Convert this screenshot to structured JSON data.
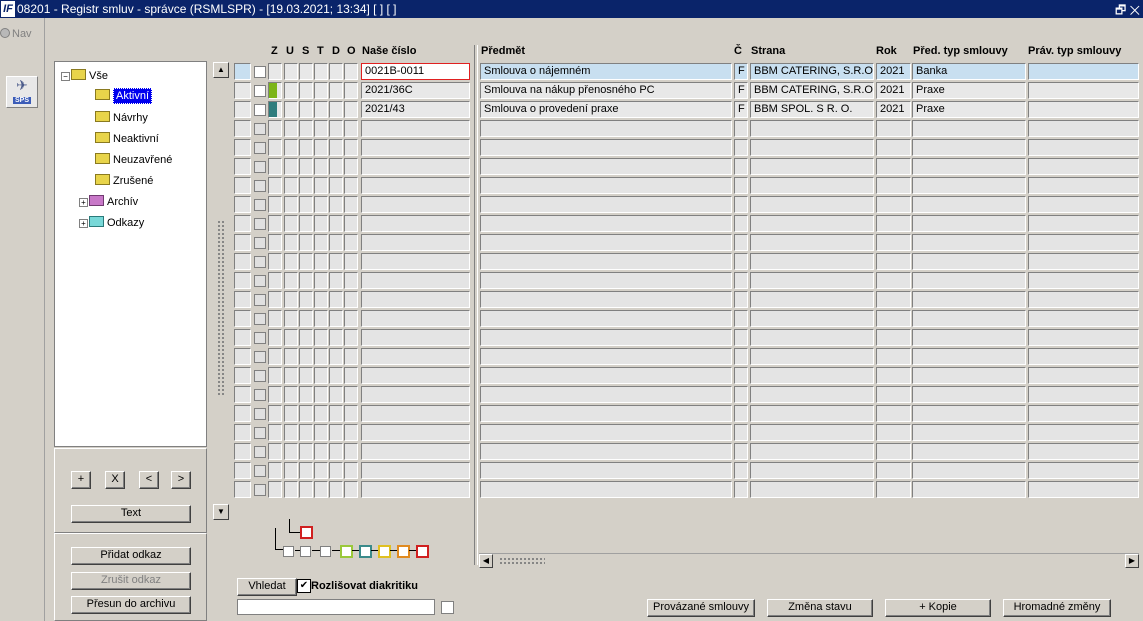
{
  "titlebar": {
    "logo": "IF",
    "title": "08201 - Registr smluv - správce (RSMLSPR) - [19.03.2021; 13:34]  [ ]  [ ]",
    "restore": "🗗",
    "close": "✕"
  },
  "nav": {
    "label": "Nav",
    "sps_label": "SPS"
  },
  "tree": {
    "root": "Vše",
    "items": [
      "Aktivní",
      "Návrhy",
      "Neaktivní",
      "Neuzavřené",
      "Zrušené"
    ],
    "archiv": "Archív",
    "odkazy": "Odkazy"
  },
  "tree_buttons": {
    "add": "+",
    "remove": "X",
    "prev": "<",
    "next": ">",
    "text": "Text"
  },
  "actions": {
    "add_link": "Přidat odkaz",
    "cancel_link": "Zrušit odkaz",
    "move_archive": "Přesun do archivu"
  },
  "grid": {
    "headers": {
      "z": "Z",
      "u": "U",
      "s": "S",
      "t": "T",
      "d": "D",
      "o": "O",
      "cislo": "Naše číslo",
      "predmet": "Předmět",
      "c": "Č",
      "strana": "Strana",
      "rok": "Rok",
      "pred_typ": "Před. typ smlouvy",
      "prav_typ": "Práv. typ smlouvy"
    },
    "rows": [
      {
        "cislo": "0021B-0011",
        "predmet": "Smlouva o nájemném",
        "c": "F",
        "strana": "BBM CATERING, S.R.O. Ú",
        "rok": "2021",
        "pred_typ": "Banka",
        "prav_typ": "",
        "status_color": ""
      },
      {
        "cislo": "2021/36C",
        "predmet": "Smlouva na nákup přenosného PC",
        "c": "F",
        "strana": "BBM CATERING, S.R.O. Ú",
        "rok": "2021",
        "pred_typ": "Praxe",
        "prav_typ": "",
        "status_color": "#7cb518"
      },
      {
        "cislo": "2021/43",
        "predmet": "Smlouva o provedení praxe",
        "c": "F",
        "strana": "BBM SPOL. S R. O.",
        "rok": "2021",
        "pred_typ": "Praxe",
        "prav_typ": "",
        "status_color": "#2f7d7d"
      }
    ],
    "empty_rows": 20
  },
  "status_colors": [
    "#a0a0a0",
    "#a0a0a0",
    "#a0a0a0",
    "#9ac83a",
    "#3a8a8a",
    "#e0c020",
    "#e08a20",
    "#d02020"
  ],
  "status_top_color": "#d02020",
  "search": {
    "button": "Vhledat",
    "diakritika_label": "Rozlišovat diakritiku",
    "diakritika_checked": "✔",
    "value": ""
  },
  "bottom_buttons": {
    "linked": "Provázané smlouvy",
    "change_state": "Změna stavu",
    "copy": "+ Kopie",
    "bulk": "Hromadné změny"
  },
  "scroll": {
    "up": "▲",
    "down": "▼",
    "left": "◀",
    "right": "▶"
  }
}
